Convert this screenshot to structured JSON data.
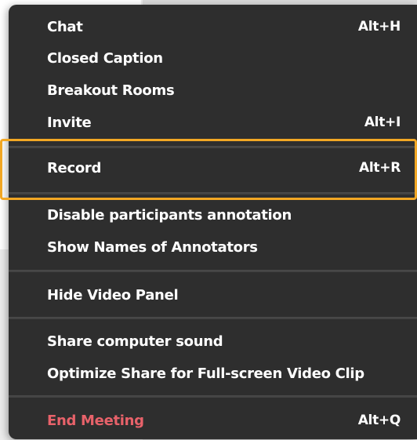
{
  "menu": {
    "items": [
      {
        "label": "Chat",
        "shortcut": "Alt+H"
      },
      {
        "label": "Closed Caption",
        "shortcut": ""
      },
      {
        "label": "Breakout Rooms",
        "shortcut": ""
      },
      {
        "label": "Invite",
        "shortcut": "Alt+I"
      },
      {
        "label": "Record",
        "shortcut": "Alt+R"
      },
      {
        "label": "Disable participants annotation",
        "shortcut": ""
      },
      {
        "label": "Show Names of Annotators",
        "shortcut": ""
      },
      {
        "label": "Hide Video Panel",
        "shortcut": ""
      },
      {
        "label": "Share computer sound",
        "shortcut": ""
      },
      {
        "label": "Optimize Share for Full-screen Video Clip",
        "shortcut": ""
      },
      {
        "label": "End Meeting",
        "shortcut": "Alt+Q"
      }
    ]
  },
  "colors": {
    "menu_background": "#2e2e2e",
    "text": "#ffffff",
    "end_meeting": "#e8626a",
    "highlight_outline": "#f2a724"
  }
}
